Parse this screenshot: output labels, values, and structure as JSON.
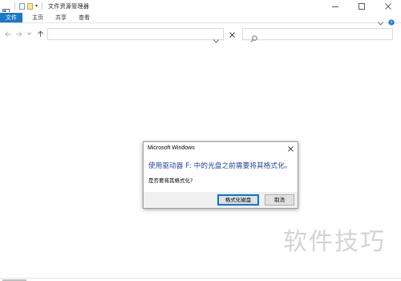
{
  "window": {
    "title": "文件资源管理器"
  },
  "ribbon": {
    "tabs": [
      {
        "label": "文件"
      },
      {
        "label": "主页"
      },
      {
        "label": "共享"
      },
      {
        "label": "查看"
      }
    ]
  },
  "address": {
    "value": "",
    "search_placeholder": ""
  },
  "dialog": {
    "title": "Microsoft Windows",
    "message": "使用驱动器 F: 中的光盘之前需要将其格式化。",
    "question": "是否要将其格式化?",
    "format_button": "格式化磁盘",
    "cancel_button": "取消"
  },
  "watermark": {
    "text": "软件技巧"
  },
  "colors": {
    "accent": "#1979ca",
    "message_text": "#1f3f9b",
    "dialog_bg": "#f0f0f0"
  }
}
